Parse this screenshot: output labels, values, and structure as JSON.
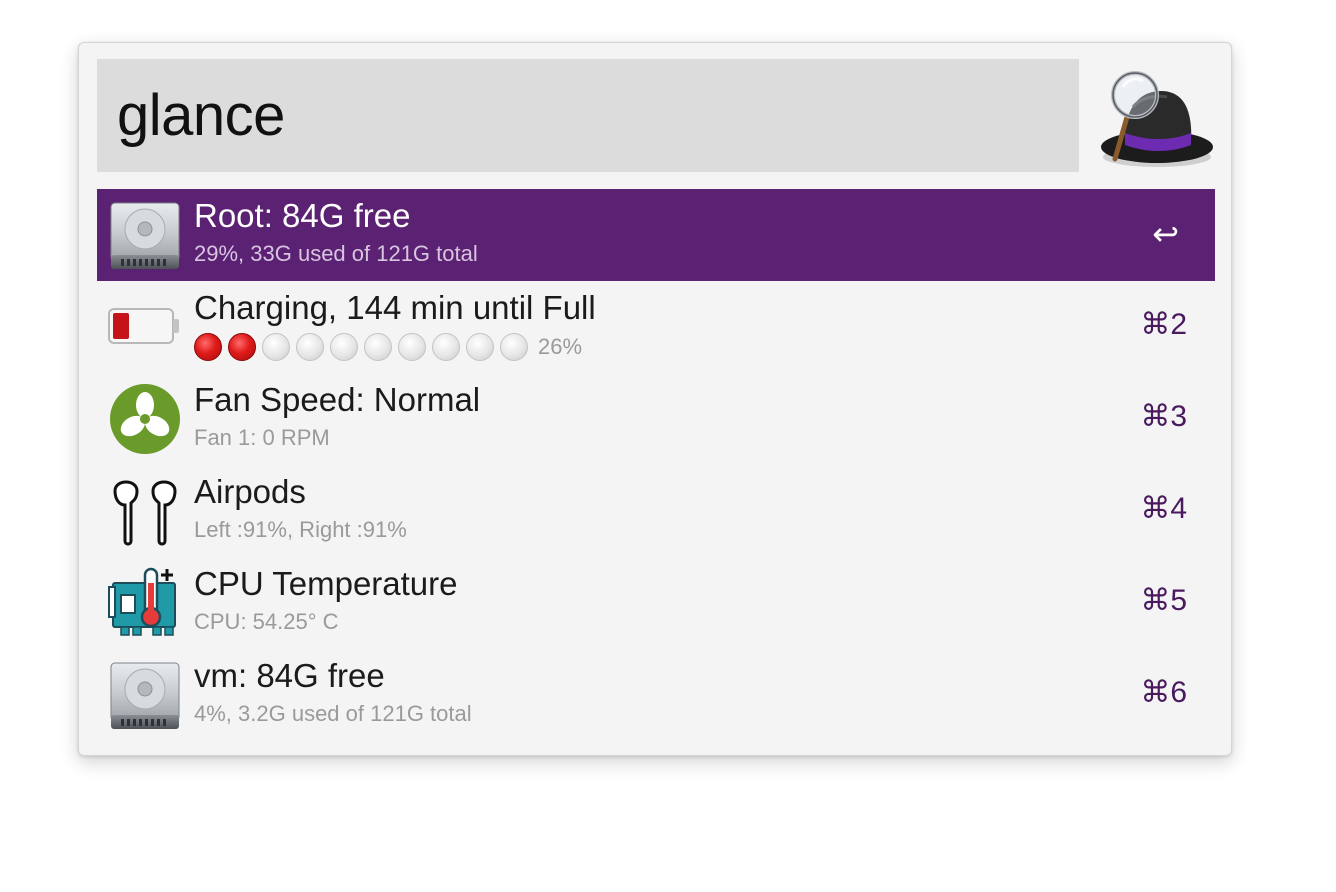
{
  "search": {
    "query": "glance"
  },
  "results": [
    {
      "title": "Root: 84G free",
      "subtitle": "29%, 33G used of 121G total",
      "shortcut": "↩",
      "icon": "hard-drive-icon",
      "selected": true
    },
    {
      "title": "Charging, 144 min until Full",
      "battery_level_percent": 26,
      "dots_filled": 2,
      "dots_total": 10,
      "subtitle": "26%",
      "shortcut": "⌘2",
      "icon": "battery-icon"
    },
    {
      "title": "Fan Speed: Normal",
      "subtitle": "Fan 1: 0 RPM",
      "shortcut": "⌘3",
      "icon": "fan-icon"
    },
    {
      "title": "Airpods",
      "subtitle": "Left :91%, Right :91%",
      "shortcut": "⌘4",
      "icon": "airpods-icon"
    },
    {
      "title": "CPU Temperature",
      "subtitle": "CPU: 54.25° C",
      "shortcut": "⌘5",
      "icon": "cpu-temperature-icon"
    },
    {
      "title": "vm: 84G free",
      "subtitle": "4%, 3.2G used of 121G total",
      "shortcut": "⌘6",
      "icon": "hard-drive-icon"
    }
  ],
  "colors": {
    "selected_row": "#5b2172",
    "shortcut": "#4a1a5e",
    "search_bg": "#dcdcdc"
  }
}
